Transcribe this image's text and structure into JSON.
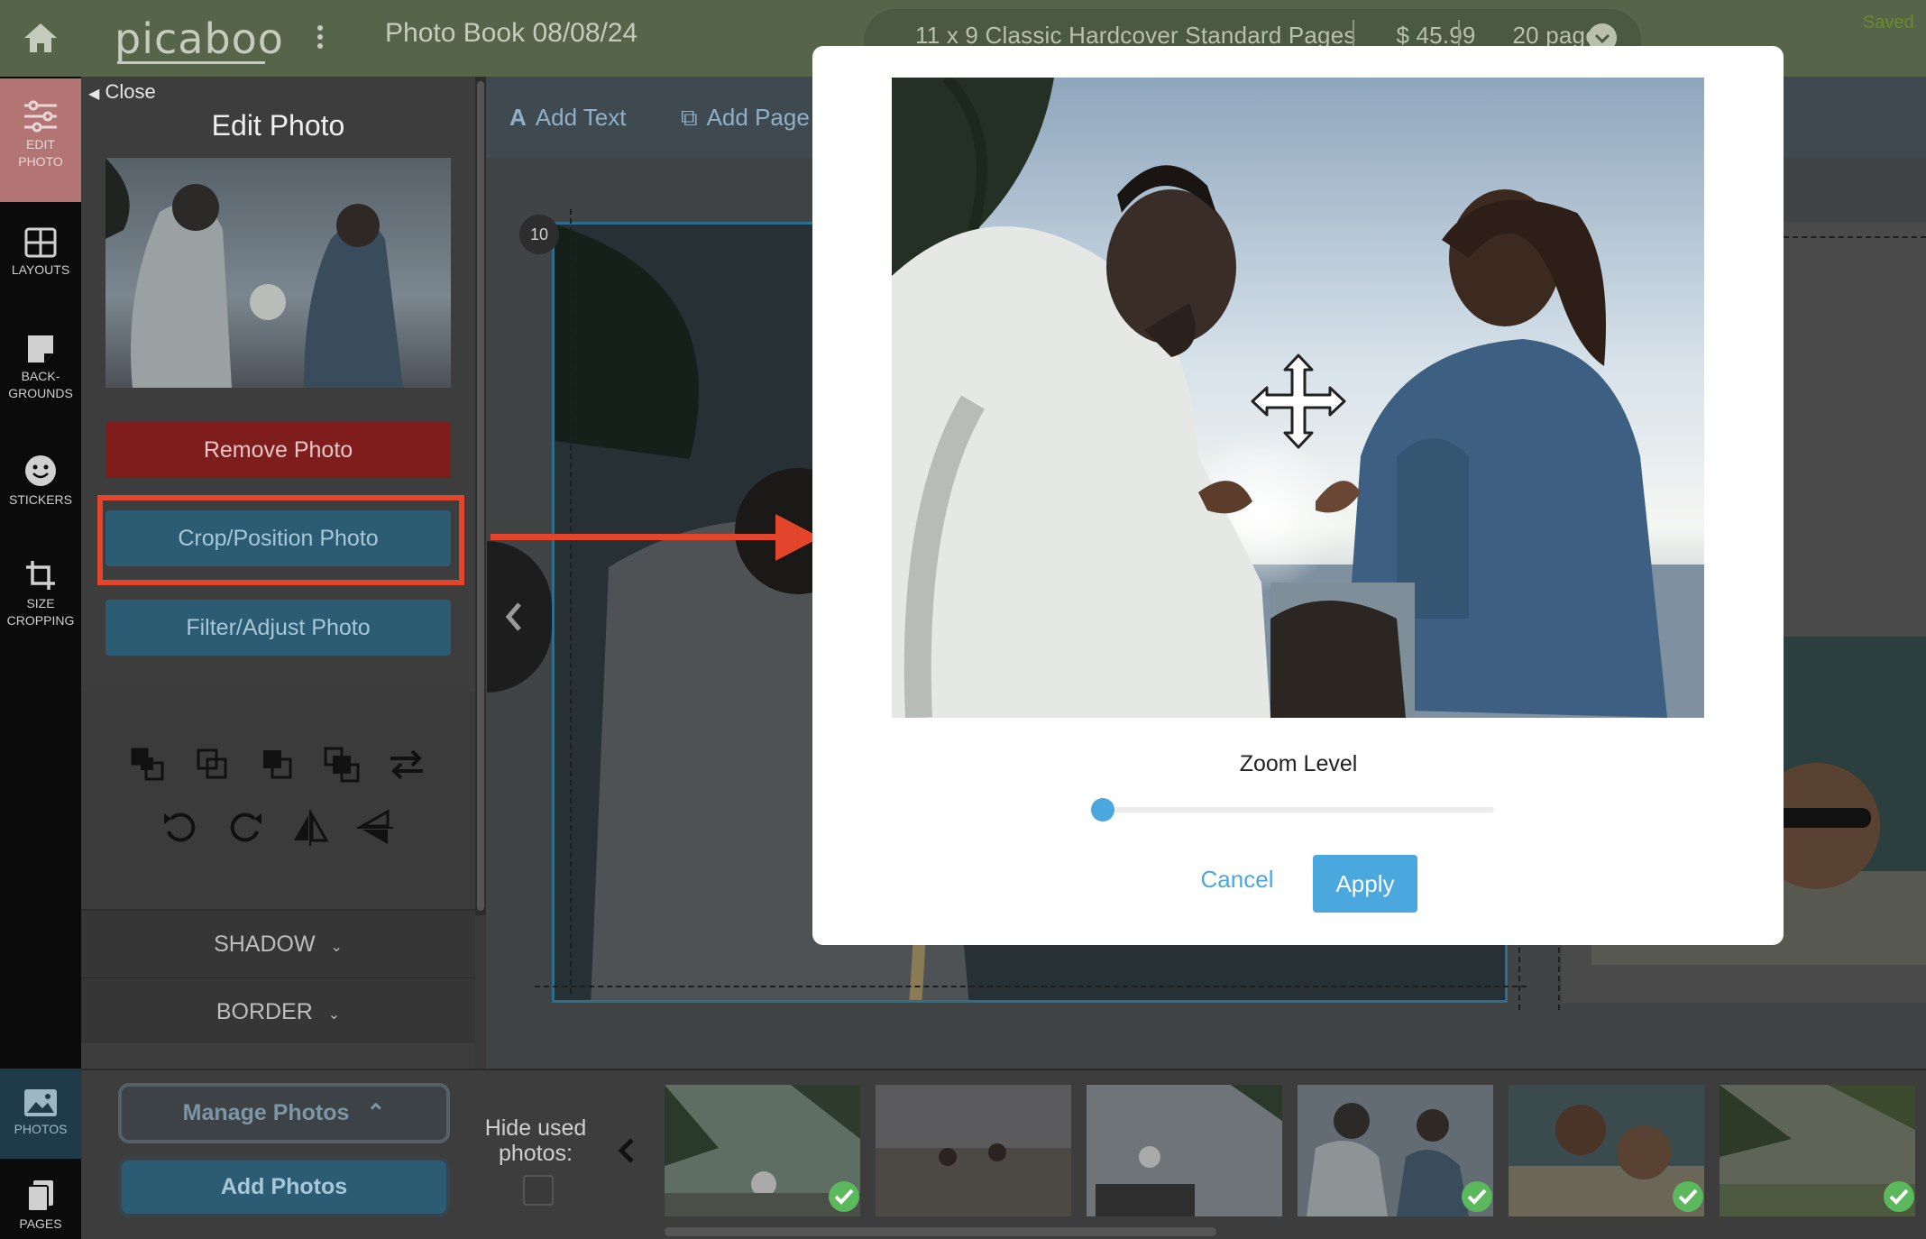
{
  "topbar": {
    "logo": "picaboo",
    "book_title": "Photo Book 08/08/24",
    "product": {
      "name": "11 x 9 Classic Hardcover Standard Pages",
      "price": "$ 45.99",
      "pages": "20 pages"
    },
    "status": "Saved"
  },
  "rail": {
    "items": [
      {
        "label_1": "EDIT",
        "label_2": "PHOTO",
        "icon": "sliders-icon",
        "active": true
      },
      {
        "label_1": "LAYOUTS",
        "label_2": "",
        "icon": "grid-icon"
      },
      {
        "label_1": "BACK-",
        "label_2": "GROUNDS",
        "icon": "background-icon"
      },
      {
        "label_1": "STICKERS",
        "label_2": "",
        "icon": "smiley-icon"
      },
      {
        "label_1": "SIZE",
        "label_2": "CROPPING",
        "icon": "crop-icon"
      }
    ],
    "bottom_items": [
      {
        "label": "PHOTOS",
        "icon": "photo-icon"
      },
      {
        "label": "PAGES",
        "icon": "pages-icon"
      }
    ]
  },
  "edit_panel": {
    "close_label": "Close",
    "title": "Edit Photo",
    "remove_label": "Remove Photo",
    "crop_label": "Crop/Position Photo",
    "filter_label": "Filter/Adjust Photo",
    "shadow_label": "SHADOW",
    "border_label": "BORDER"
  },
  "editor": {
    "add_text_label": "Add Text",
    "add_page_label": "Add Page",
    "page_number": "10"
  },
  "bottom": {
    "manage_label": "Manage Photos",
    "add_label": "Add Photos",
    "hide_used_line1": "Hide used",
    "hide_used_line2": "photos:",
    "thumbs_used": [
      true,
      false,
      false,
      true,
      true,
      true
    ]
  },
  "modal": {
    "zoom_label": "Zoom Level",
    "zoom_value": 0,
    "cancel_label": "Cancel",
    "apply_label": "Apply"
  },
  "colors": {
    "topbar": "#56654a",
    "accent_blue": "#4aa8de",
    "remove_red": "#7e1d1b",
    "highlight_orange": "#e2452b",
    "used_check": "#5cb85c"
  }
}
